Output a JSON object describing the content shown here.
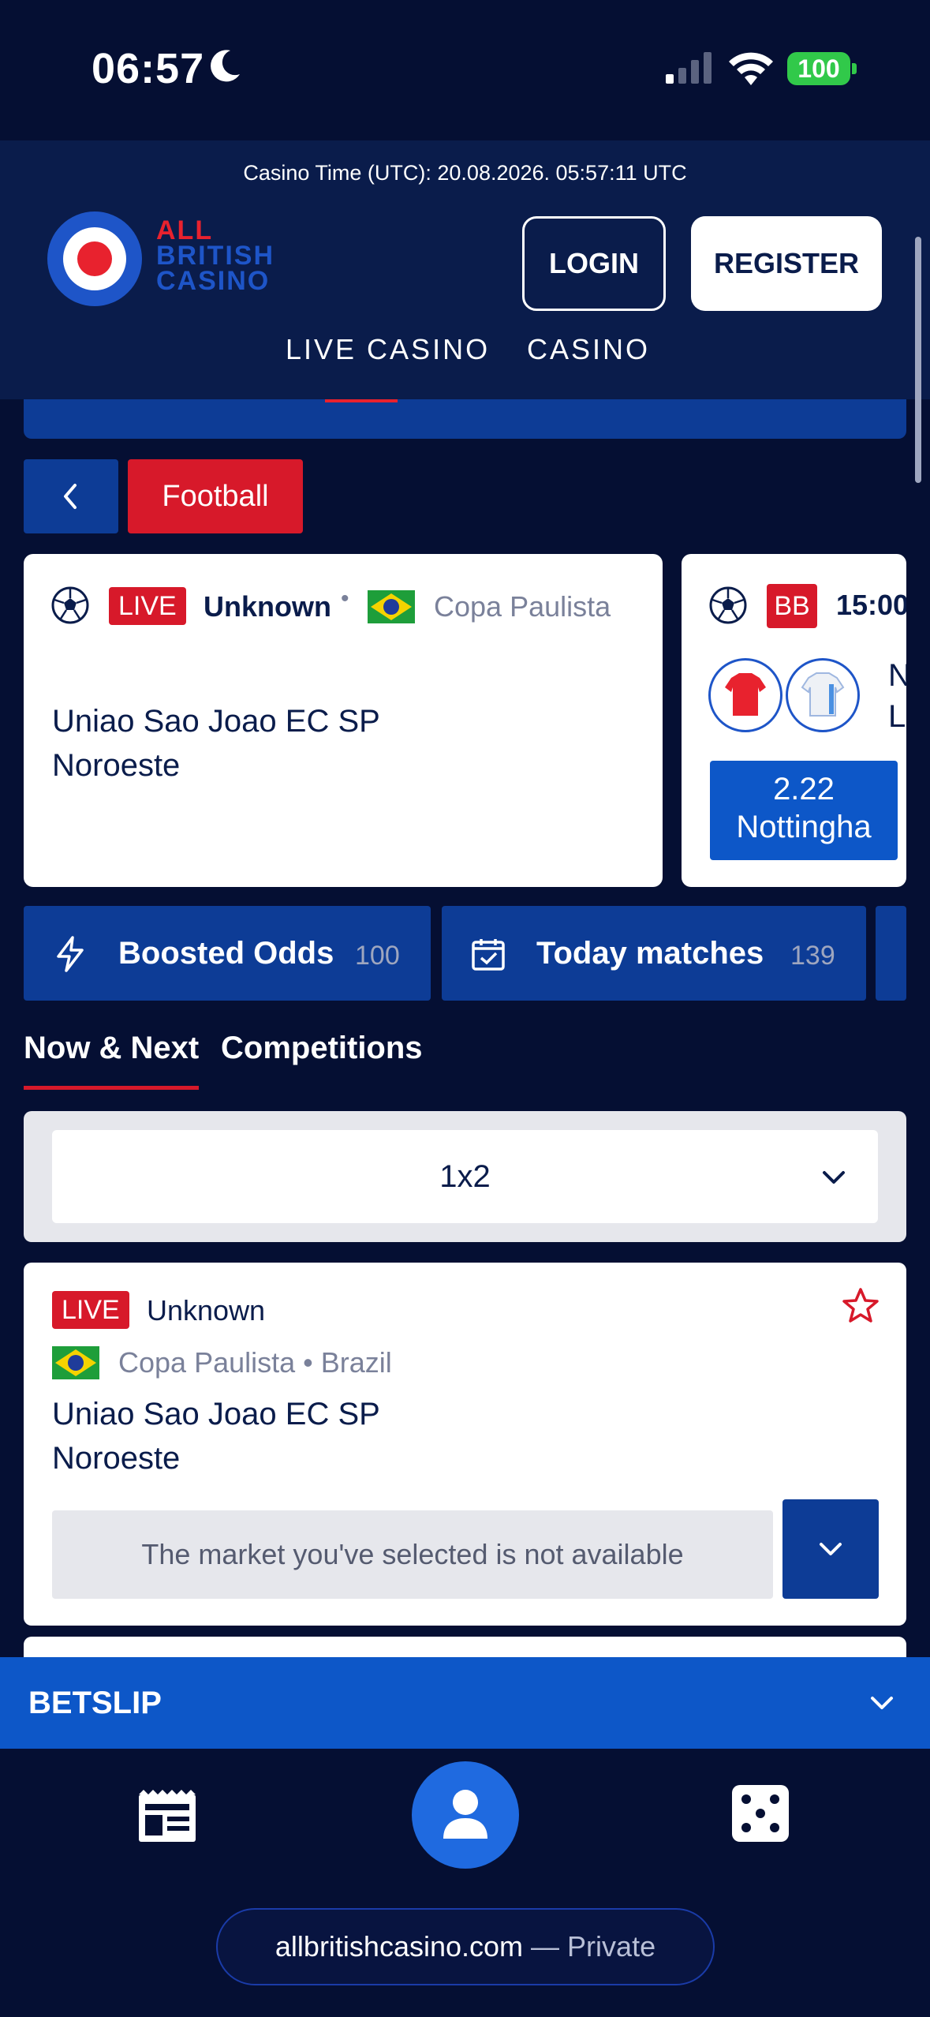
{
  "status_bar": {
    "time": "06:57",
    "battery": "100"
  },
  "header": {
    "casino_time": "Casino Time (UTC): 20.08.2026. 05:57:11 UTC",
    "logo_line1": "ALL",
    "logo_line2": "BRITISH",
    "logo_line3": "CASINO",
    "login_label": "LOGIN",
    "register_label": "REGISTER",
    "nav": [
      "LIVE CASINO",
      "CASINO"
    ]
  },
  "breadcrumb": {
    "sport": "Football"
  },
  "featured": [
    {
      "badge": "LIVE",
      "status": "Unknown",
      "competition": "Copa Paulista",
      "home": "Uniao Sao Joao EC SP",
      "away": "Noroeste"
    },
    {
      "badge": "BB",
      "time": "15:00",
      "home_initial": "N",
      "away_initial": "L",
      "odds": "2.22",
      "odds_team": "Nottingha"
    }
  ],
  "quick_tiles": [
    {
      "label": "Boosted Odds",
      "count": "100"
    },
    {
      "label": "Today matches",
      "count": "139"
    }
  ],
  "tabs": [
    "Now & Next",
    "Competitions"
  ],
  "market": {
    "selected": "1x2"
  },
  "match": {
    "badge": "LIVE",
    "status": "Unknown",
    "competition": "Copa Paulista • Brazil",
    "home": "Uniao Sao Joao EC SP",
    "away": "Noroeste",
    "notice": "The market you've selected is not available"
  },
  "betslip": {
    "label": "BETSLIP"
  },
  "browser": {
    "host": "allbritishcasino.com",
    "mode": "— Private"
  },
  "colors": {
    "navy": "#050f33",
    "header": "#0a1c4b",
    "accent_red": "#d7192a",
    "accent_blue": "#0d57c8"
  }
}
